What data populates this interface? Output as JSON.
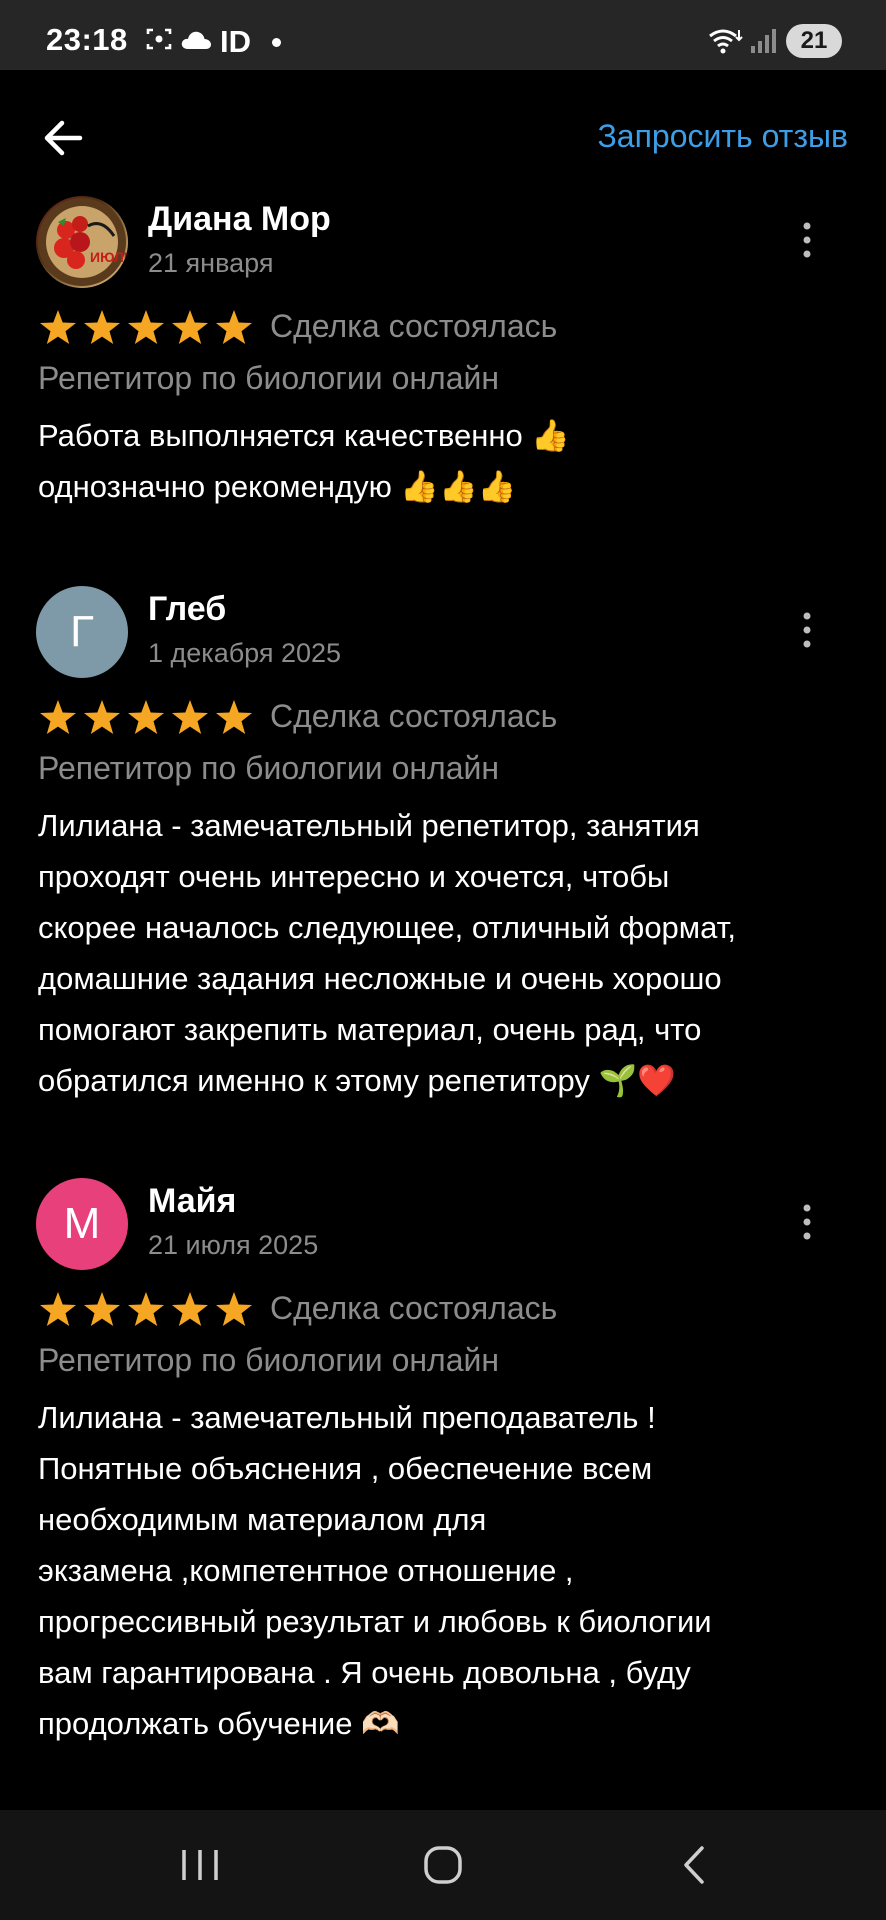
{
  "status_bar": {
    "time": "23:18",
    "network_label": "ID",
    "battery": "21",
    "icons": [
      "screen-record-icon",
      "cloud-icon",
      "wifi-icon",
      "signal-icon"
    ]
  },
  "header": {
    "back_icon": "arrow-left-icon",
    "request_review_label": "Запросить отзыв",
    "accent_color": "#3d9ee8"
  },
  "reviews": [
    {
      "name": "Диана Мор",
      "date": "21 января",
      "avatar_type": "photo",
      "avatar_letter": "",
      "avatar_color": "",
      "rating": 5,
      "deal_status": "Сделка состоялась",
      "service": "Репетитор по биологии онлайн",
      "text": "Работа выполняется качественно 👍\nоднозначно рекомендую 👍👍👍"
    },
    {
      "name": "Глеб",
      "date": "1 декабря 2025",
      "avatar_type": "letter",
      "avatar_letter": "Г",
      "avatar_color": "#7e99a8",
      "rating": 5,
      "deal_status": "Сделка состоялась",
      "service": "Репетитор по биологии онлайн",
      "text": "Лилиана - замечательный  репетитор, занятия\nпроходят очень интересно и хочется, чтобы\nскорее началось следующее, отличный формат,\nдомашние задания несложные и очень хорошо\nпомогают закрепить материал, очень рад, что\nобратился именно к этому репетитору 🌱❤️"
    },
    {
      "name": "Майя",
      "date": "21 июля 2025",
      "avatar_type": "letter",
      "avatar_letter": "М",
      "avatar_color": "#e8407a",
      "rating": 5,
      "deal_status": "Сделка состоялась",
      "service": "Репетитор по биологии онлайн",
      "text": "Лилиана  - замечательный преподаватель !\nПонятные объяснения ,  обеспечение всем\nнеобходимым материалом для\nэкзамена ,компетентное отношение ,\nпрогрессивный результат и любовь к биологии\nвам гарантирована . Я очень довольна , буду\nпродолжать обучение 🫶🏻"
    }
  ],
  "colors": {
    "background": "#000000",
    "star": "#f5a623",
    "muted_text": "#8c8c8c"
  },
  "nav_bar": {
    "icons": [
      "recent-apps-icon",
      "home-icon",
      "back-nav-icon"
    ]
  }
}
